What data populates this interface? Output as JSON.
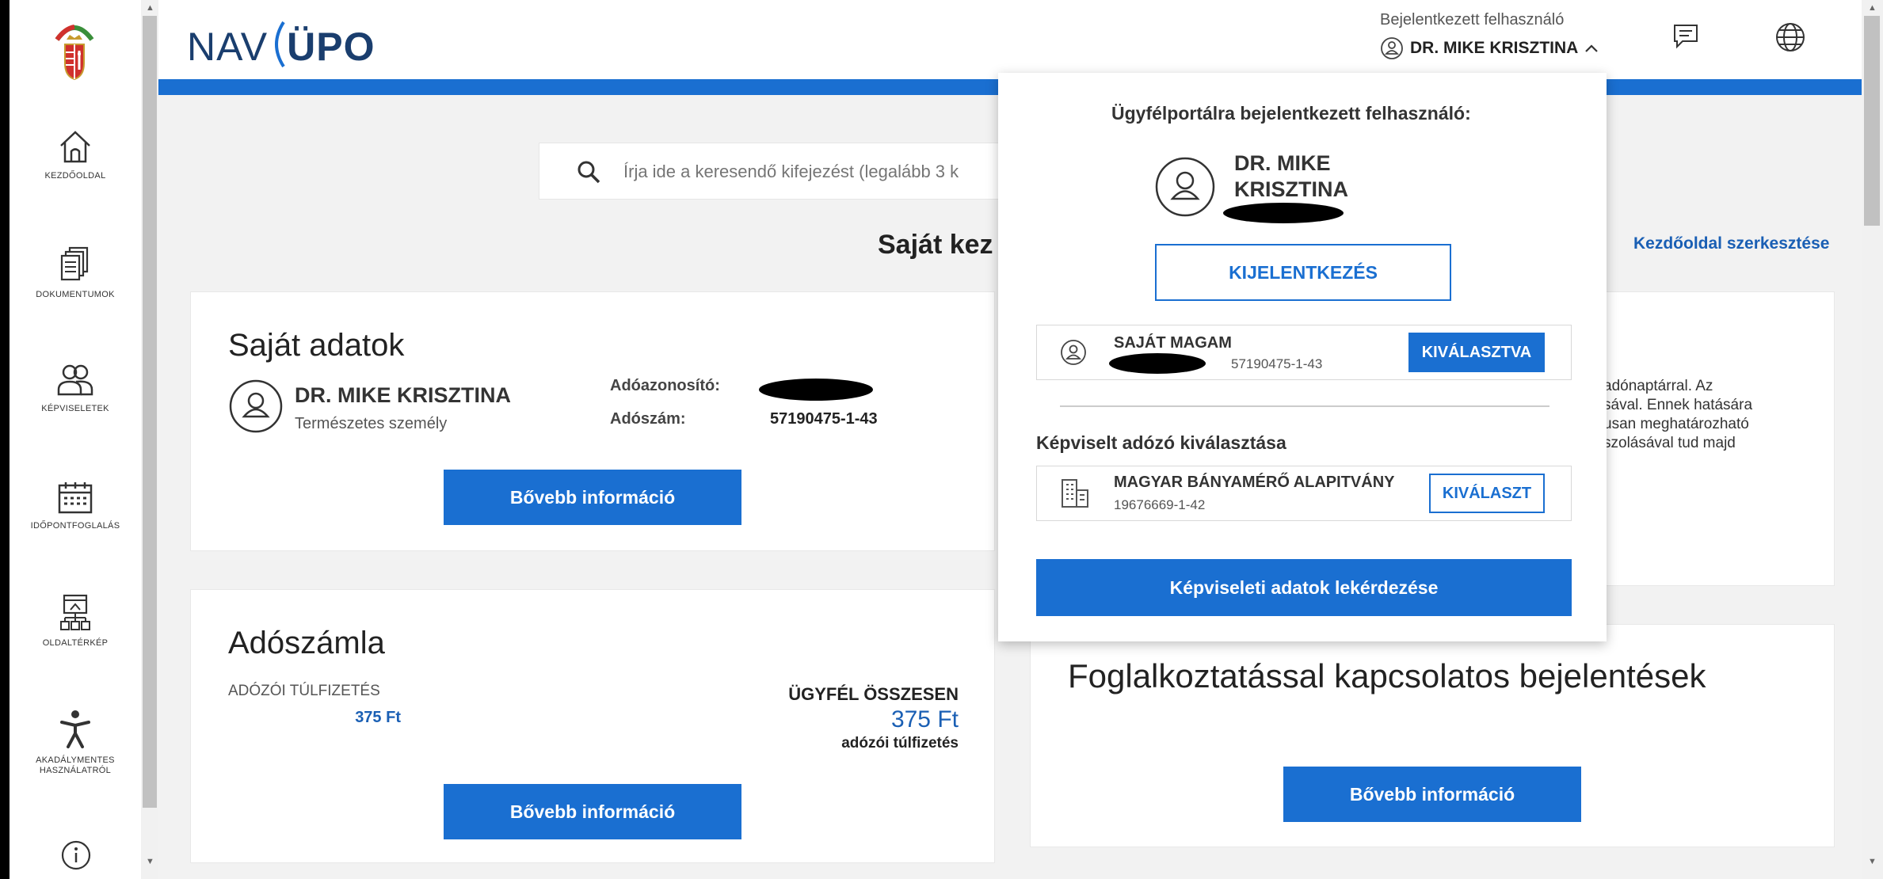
{
  "sidebar": {
    "items": [
      {
        "label": "KEZDŐOLDAL",
        "icon": "home-icon"
      },
      {
        "label": "DOKUMENTUMOK",
        "icon": "documents-icon"
      },
      {
        "label": "KÉPVISELETEK",
        "icon": "representations-icon"
      },
      {
        "label": "IDŐPONTFOGLALÁS",
        "icon": "calendar-icon"
      },
      {
        "label": "OLDALTÉRKÉP",
        "icon": "sitemap-icon"
      },
      {
        "label": "AKADÁLYMENTES HASZNÁLATRÓL",
        "icon": "accessibility-icon"
      }
    ]
  },
  "header": {
    "logo_prefix": "NAV",
    "logo_brand": "ÜPO",
    "user_caption": "Bejelentkezett felhasználó",
    "user_name": "DR. MIKE KRISZTINA"
  },
  "search": {
    "placeholder": "Írja ide a keresendő kifejezést (legalább 3 k"
  },
  "main": {
    "section_title": "Saját kez",
    "edit_link": "Kezdőoldal szerkesztése"
  },
  "own_data_card": {
    "title": "Saját adatok",
    "name": "DR. MIKE KRISZTINA",
    "person_type": "Természetes személy",
    "tax_id_label": "Adóazonosító:",
    "tax_number_label": "Adószám:",
    "tax_number": "57190475-1-43",
    "button": "Bővebb információ"
  },
  "account_card": {
    "title": "Adószámla",
    "overpay_label": "ADÓZÓI TÚLFIZETÉS",
    "overpay_value": "375 Ft",
    "total_label": "ÜGYFÉL ÖSSZESEN",
    "total_value": "375 Ft",
    "total_note": "adózói túlfizetés",
    "button": "Bővebb információ"
  },
  "right_card": {
    "text_lines": [
      "adónaptárral. Az",
      "sával. Ennek hatására",
      "usan meghatározható",
      "szolásával tud majd"
    ]
  },
  "employment_card": {
    "title": "Foglalkoztatással kapcsolatos bejelentések",
    "button": "Bővebb információ"
  },
  "dropdown": {
    "heading": "Ügyfélportálra bejelentkezett felhasználó:",
    "name_line1": "DR. MIKE",
    "name_line2": "KRISZTINA",
    "logout_button": "KIJELENTKEZÉS",
    "self_title": "SAJÁT MAGAM",
    "self_id": "57190475-1-43",
    "selected_button": "KIVÁLASZTVA",
    "represented_heading": "Képviselt adózó kiválasztása",
    "org_title": "MAGYAR BÁNYAMÉRŐ ALAPITVÁNY",
    "org_id": "19676669-1-42",
    "select_button": "KIVÁLASZT",
    "query_button": "Képviseleti adatok lekérdezése"
  },
  "colors": {
    "primary": "#1a6fd1",
    "link": "#1a5fb4",
    "brand_dark": "#1a3e6e",
    "background": "#f2f2f2"
  }
}
